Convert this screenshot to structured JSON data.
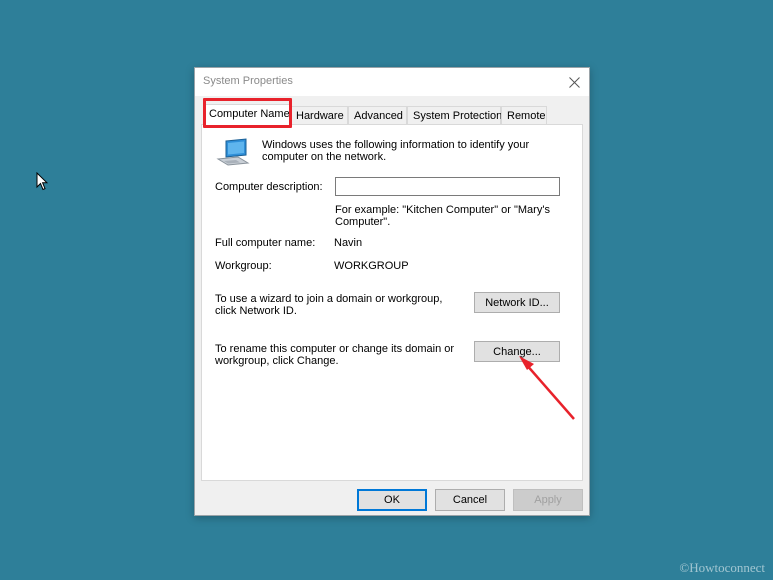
{
  "dialog": {
    "title": "System Properties",
    "tabs": [
      {
        "label": "Computer Name",
        "active": true
      },
      {
        "label": "Hardware",
        "active": false
      },
      {
        "label": "Advanced",
        "active": false
      },
      {
        "label": "System Protection",
        "active": false
      },
      {
        "label": "Remote",
        "active": false
      }
    ],
    "info_text": "Windows uses the following information to identify your computer on the network.",
    "description": {
      "label": "Computer description:",
      "value": "",
      "example": "For example: \"Kitchen Computer\" or \"Mary's Computer\"."
    },
    "full_name": {
      "label": "Full computer name:",
      "value": "Navin"
    },
    "workgroup": {
      "label": "Workgroup:",
      "value": "WORKGROUP"
    },
    "network_id": {
      "text": "To use a wizard to join a domain or workgroup, click Network ID.",
      "button": "Network ID..."
    },
    "rename": {
      "text": "To rename this computer or change its domain or workgroup, click Change.",
      "button": "Change..."
    },
    "footer": {
      "ok": "OK",
      "cancel": "Cancel",
      "apply": "Apply"
    }
  },
  "watermark": "©Howtoconnect",
  "colors": {
    "desktop": "#2e7f99",
    "highlight": "#e8222b",
    "default_button_border": "#0078d7",
    "arrow": "#e8222b"
  },
  "icons": {
    "cursor": "mouse-pointer-icon",
    "close": "close-icon",
    "computer": "computer-network-icon",
    "annotation": "red-arrow-icon"
  }
}
